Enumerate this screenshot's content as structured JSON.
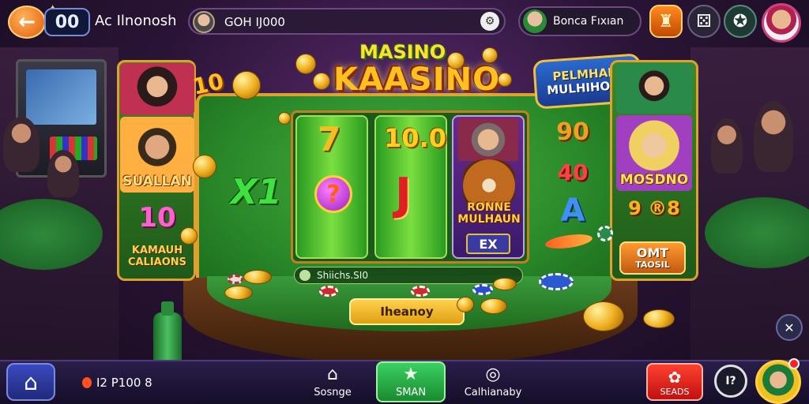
{
  "top_bar": {
    "back_icon": "arrow-left-icon",
    "level": "00",
    "player_name": "Ac Ilnonosh",
    "balance": "GOH IJ000",
    "friend_label": "Bonca Fıxıan"
  },
  "game": {
    "title_top": "MASINO",
    "title_main": "KAASINO",
    "banner_line1": "PELMHAIN",
    "banner_line2": "MULHIHOUN",
    "left_panel": {
      "label1": "SUALLAN",
      "label2": "10",
      "label3a": "KAMAUH",
      "label3b": "CALIAONS",
      "tag": "10"
    },
    "reels": {
      "reel1_top": "7",
      "reel1_mid": "?",
      "reel2_top": "10.0",
      "reel2_mid": "J",
      "reel3_line1": "RONNE",
      "reel3_line2": "MULHAUN",
      "reel3_tag": "EX"
    },
    "x1_symbol": "X1",
    "right_symbols": {
      "s1": "90",
      "s2": "40",
      "s3": "A"
    },
    "right_panel": {
      "label1": "MOSDNO",
      "label2": "9 ®8",
      "button_line1": "OMT",
      "button_line2": "TAOSIL"
    },
    "stake_text": "Shiichs.SI0",
    "cta_label": "Iheanoy"
  },
  "bottom_bar": {
    "coin_amount": "I2 P100 8",
    "nav": [
      {
        "label": "Sosnge",
        "icon": "scene-icon"
      },
      {
        "label": "SMAN",
        "icon": "star-icon"
      },
      {
        "label": "Calhianaby",
        "icon": "community-icon"
      },
      {
        "label": "SEADS",
        "icon": "store-icon"
      }
    ],
    "settings_text": "I?"
  },
  "colors": {
    "background": "#2a1436",
    "felt": "#2a8a2a",
    "gold": "#e0a030",
    "accent_green": "#3ad060",
    "accent_red": "#ff4030"
  }
}
